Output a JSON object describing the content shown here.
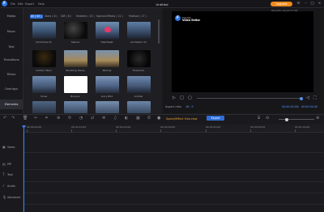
{
  "titlebar": {
    "menu": [
      "File",
      "Edit",
      "Export",
      "Help"
    ],
    "title": "Untitled",
    "upgrade_label": "Upgrade",
    "logo_glyph": "F"
  },
  "sidebar": {
    "items": [
      {
        "label": "Media",
        "active": false
      },
      {
        "label": "Music",
        "active": false
      },
      {
        "label": "Text",
        "active": false
      },
      {
        "label": "Transitions",
        "active": false
      },
      {
        "label": "Filters",
        "active": false
      },
      {
        "label": "Overlays",
        "active": false
      },
      {
        "label": "Elements",
        "active": true
      }
    ]
  },
  "browser": {
    "tabs": [
      {
        "label": "All ( 63 )",
        "active": true
      },
      {
        "label": "Stars ( 8 )",
        "active": false
      },
      {
        "label": "Gift ( 8 )",
        "active": false
      },
      {
        "label": "Emblem ( 15 )",
        "active": false
      },
      {
        "label": "Special Effects ( 21 )",
        "active": false
      },
      {
        "label": "Festival ( 17 )",
        "active": false
      }
    ],
    "tiles": [
      {
        "label": "Christmas 01"
      },
      {
        "label": "Sakura"
      },
      {
        "label": "Heartbeat"
      },
      {
        "label": "Animation 01"
      },
      {
        "label": "Golden Stars"
      },
      {
        "label": "Twinkling Starry"
      },
      {
        "label": "Melody"
      },
      {
        "label": "Fireworks"
      },
      {
        "label": "Snow"
      },
      {
        "label": "Bonjour"
      },
      {
        "label": "Ivory Bird"
      },
      {
        "label": "Animal"
      },
      {
        "label": ""
      },
      {
        "label": ""
      },
      {
        "label": ""
      },
      {
        "label": ""
      }
    ]
  },
  "preview": {
    "recent_tag": "Recently saved 17:00",
    "brand_line1": "FlexClip",
    "brand_line2": "Video Editor",
    "aspect_label": "Aspect ratio",
    "aspect_value": "16 : 9",
    "time_current": "00:00:00.00",
    "time_total": "00:00:00.00"
  },
  "toolbar": {
    "speed_label": "Speed/Effect Overview",
    "export_label": "Export"
  },
  "timeline": {
    "ruler": [
      "00:00:00.00",
      "00:00:10.00",
      "00:00:20.00",
      "00:00:30.00",
      "00:00:40.00",
      "00:00:50.00",
      "00:01:00.00"
    ],
    "tracks": [
      {
        "label": "Video",
        "icon": "video-icon"
      },
      {
        "label": "PIP",
        "icon": "pip-icon"
      },
      {
        "label": "Text",
        "icon": "text-icon"
      },
      {
        "label": "Audio",
        "icon": "audio-icon"
      },
      {
        "label": "Voiceover",
        "icon": "microphone-icon"
      }
    ]
  },
  "colors": {
    "accent": "#2f6fd8",
    "upgrade": "#f08a1c",
    "speed_label": "#f0a236"
  }
}
